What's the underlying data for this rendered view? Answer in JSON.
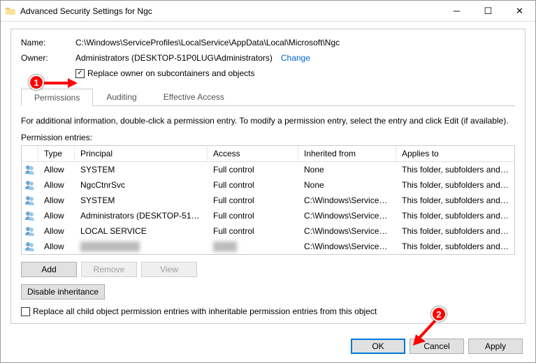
{
  "window": {
    "title": "Advanced Security Settings for Ngc"
  },
  "fields": {
    "name_label": "Name:",
    "name_value": "C:\\Windows\\ServiceProfiles\\LocalService\\AppData\\Local\\Microsoft\\Ngc",
    "owner_label": "Owner:",
    "owner_value": "Administrators (DESKTOP-51P0LUG\\Administrators)",
    "change_link": "Change",
    "replace_owner_label": "Replace owner on subcontainers and objects",
    "replace_owner_checked": "✓"
  },
  "tabs": {
    "permissions": "Permissions",
    "auditing": "Auditing",
    "effective": "Effective Access"
  },
  "info_text": "For additional information, double-click a permission entry. To modify a permission entry, select the entry and click Edit (if available).",
  "entries_label": "Permission entries:",
  "columns": {
    "type": "Type",
    "principal": "Principal",
    "access": "Access",
    "inherited": "Inherited from",
    "applies": "Applies to"
  },
  "entries": [
    {
      "type": "Allow",
      "principal": "SYSTEM",
      "access": "Full control",
      "inherited": "None",
      "applies": "This folder, subfolders and files"
    },
    {
      "type": "Allow",
      "principal": "NgcCtnrSvc",
      "access": "Full control",
      "inherited": "None",
      "applies": "This folder, subfolders and files"
    },
    {
      "type": "Allow",
      "principal": "SYSTEM",
      "access": "Full control",
      "inherited": "C:\\Windows\\ServicePr...",
      "applies": "This folder, subfolders and files"
    },
    {
      "type": "Allow",
      "principal": "Administrators (DESKTOP-51P...",
      "access": "Full control",
      "inherited": "C:\\Windows\\ServicePr...",
      "applies": "This folder, subfolders and files"
    },
    {
      "type": "Allow",
      "principal": "LOCAL SERVICE",
      "access": "Full control",
      "inherited": "C:\\Windows\\ServicePr...",
      "applies": "This folder, subfolders and files"
    },
    {
      "type": "Allow",
      "principal": "██████████",
      "access": "████",
      "inherited": "C:\\Windows\\ServicePr...",
      "applies": "This folder, subfolders and files"
    }
  ],
  "buttons": {
    "add": "Add",
    "remove": "Remove",
    "view": "View",
    "disable_inheritance": "Disable inheritance",
    "replace_child": "Replace all child object permission entries with inheritable permission entries from this object",
    "ok": "OK",
    "cancel": "Cancel",
    "apply": "Apply"
  },
  "callouts": {
    "one": "1",
    "two": "2"
  }
}
